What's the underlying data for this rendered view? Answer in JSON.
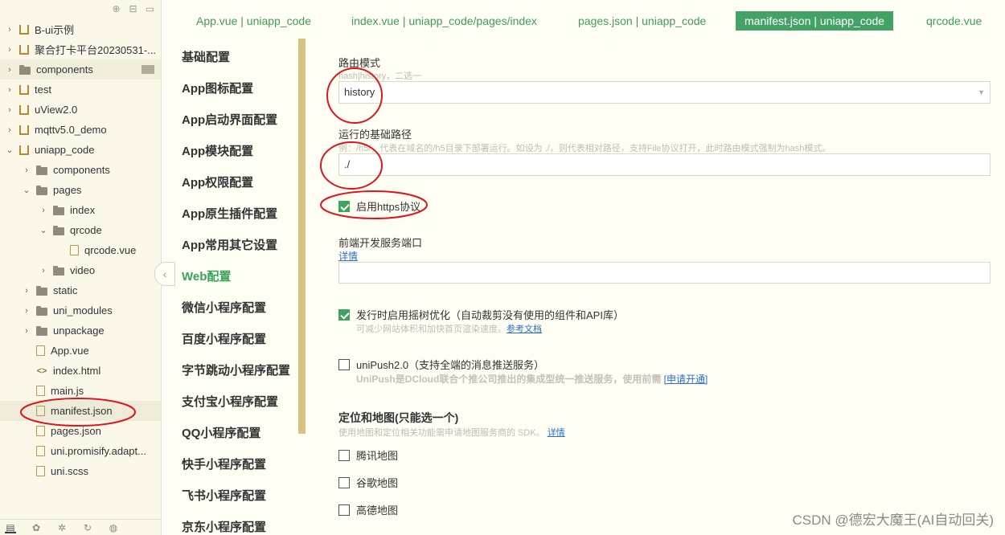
{
  "tree": {
    "items": [
      {
        "label": "B-ui示例",
        "type": "proj",
        "depth": 0,
        "arrow": "›"
      },
      {
        "label": "聚合打卡平台20230531-...",
        "type": "proj",
        "depth": 0,
        "arrow": "›"
      },
      {
        "label": "components",
        "type": "folder",
        "depth": 0,
        "arrow": "›"
      },
      {
        "label": "test",
        "type": "proj",
        "depth": 0,
        "arrow": "›"
      },
      {
        "label": "uView2.0",
        "type": "proj",
        "depth": 0,
        "arrow": "›"
      },
      {
        "label": "mqttv5.0_demo",
        "type": "proj",
        "depth": 0,
        "arrow": "›"
      },
      {
        "label": "uniapp_code",
        "type": "proj",
        "depth": 0,
        "arrow": "⌄"
      },
      {
        "label": "components",
        "type": "folder",
        "depth": 1,
        "arrow": "›"
      },
      {
        "label": "pages",
        "type": "folder",
        "depth": 1,
        "arrow": "⌄"
      },
      {
        "label": "index",
        "type": "folder",
        "depth": 2,
        "arrow": "›"
      },
      {
        "label": "qrcode",
        "type": "folder",
        "depth": 2,
        "arrow": "⌄"
      },
      {
        "label": "qrcode.vue",
        "type": "file",
        "depth": 3,
        "arrow": ""
      },
      {
        "label": "video",
        "type": "folder",
        "depth": 2,
        "arrow": "›"
      },
      {
        "label": "static",
        "type": "folder",
        "depth": 1,
        "arrow": "›"
      },
      {
        "label": "uni_modules",
        "type": "folder",
        "depth": 1,
        "arrow": "›"
      },
      {
        "label": "unpackage",
        "type": "folder",
        "depth": 1,
        "arrow": "›"
      },
      {
        "label": "App.vue",
        "type": "file",
        "depth": 1,
        "arrow": ""
      },
      {
        "label": "index.html",
        "type": "code",
        "depth": 1,
        "arrow": ""
      },
      {
        "label": "main.js",
        "type": "file",
        "depth": 1,
        "arrow": ""
      },
      {
        "label": "manifest.json",
        "type": "file",
        "depth": 1,
        "arrow": ""
      },
      {
        "label": "pages.json",
        "type": "file",
        "depth": 1,
        "arrow": ""
      },
      {
        "label": "uni.promisify.adapt...",
        "type": "file",
        "depth": 1,
        "arrow": ""
      },
      {
        "label": "uni.scss",
        "type": "file",
        "depth": 1,
        "arrow": ""
      }
    ]
  },
  "tabs": [
    {
      "label": "App.vue | uniapp_code"
    },
    {
      "label": "index.vue | uniapp_code/pages/index"
    },
    {
      "label": "pages.json | uniapp_code"
    },
    {
      "label": "manifest.json | uniapp_code"
    },
    {
      "label": "qrcode.vue"
    }
  ],
  "nav": [
    {
      "label": "基础配置"
    },
    {
      "label": "App图标配置"
    },
    {
      "label": "App启动界面配置"
    },
    {
      "label": "App模块配置"
    },
    {
      "label": "App权限配置"
    },
    {
      "label": "App原生插件配置"
    },
    {
      "label": "App常用其它设置"
    },
    {
      "label": "Web配置"
    },
    {
      "label": "微信小程序配置"
    },
    {
      "label": "百度小程序配置"
    },
    {
      "label": "字节跳动小程序配置"
    },
    {
      "label": "支付宝小程序配置"
    },
    {
      "label": "QQ小程序配置"
    },
    {
      "label": "快手小程序配置"
    },
    {
      "label": "飞书小程序配置"
    },
    {
      "label": "京东小程序配置"
    }
  ],
  "form": {
    "router_label": "路由模式",
    "router_hint": "hash|history，二选一",
    "router_value": "history",
    "base_label": "运行的基础路径",
    "base_hint": "例：/h5/，代表在域名的/h5目录下部署运行。如设为 ./，则代表相对路径，支持File协议打开，此时路由模式强制为hash模式。",
    "base_value": "./",
    "https_label": "启用https协议",
    "port_label": "前端开发服务端口",
    "port_link": "详情",
    "port_value": "",
    "treeshake_label": "发行时启用摇树优化（自动裁剪没有使用的组件和API库）",
    "treeshake_hint": "可减少网站体积和加快首页渲染速度。",
    "treeshake_link": "参考文档",
    "unipush_label": "uniPush2.0（支持全端的消息推送服务）",
    "unipush_hint": "UniPush是DCloud联合个推公司推出的集成型统一推送服务，使用前需",
    "unipush_link": "[申请开通]",
    "map_title": "定位和地图(只能选一个)",
    "map_hint": "使用地图和定位相关功能需申请地图服务商的 SDK。",
    "map_link": "详情",
    "map_options": [
      "腾讯地图",
      "谷歌地图",
      "高德地图"
    ]
  },
  "watermark": "CSDN @德宏大魔王(AI自动回关)"
}
